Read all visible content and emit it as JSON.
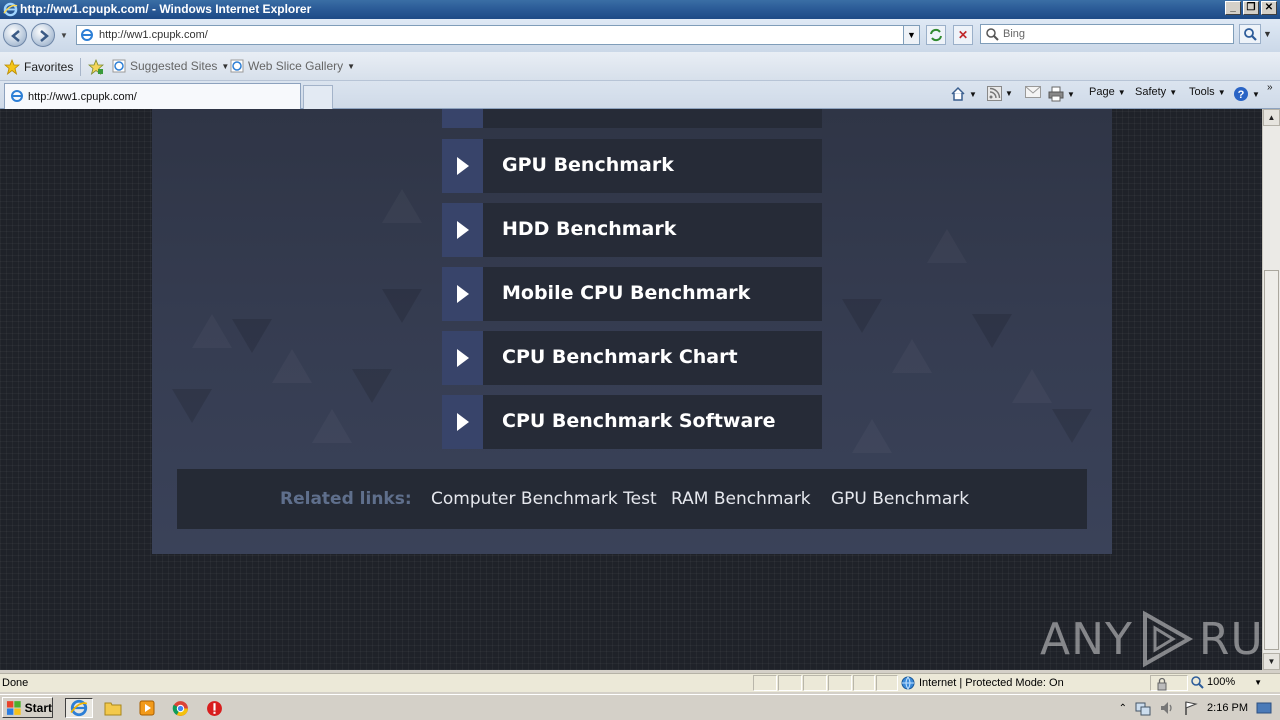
{
  "window": {
    "title": "http://ww1.cpupk.com/ - Windows Internet Explorer",
    "controls": {
      "minimize": "_",
      "maximize": "❐",
      "close": "✕"
    }
  },
  "address_bar": {
    "url": "http://ww1.cpupk.com/",
    "search_placeholder": "Bing"
  },
  "favorites_bar": {
    "favorites_label": "Favorites",
    "suggested_sites": "Suggested Sites",
    "web_slice_gallery": "Web Slice Gallery"
  },
  "tabs": {
    "active_tab_label": "http://ww1.cpupk.com/"
  },
  "command_bar": {
    "page": "Page",
    "safety": "Safety",
    "tools": "Tools"
  },
  "page": {
    "menu_items": [
      {
        "label": "GPU Benchmark"
      },
      {
        "label": "HDD Benchmark"
      },
      {
        "label": "Mobile CPU Benchmark"
      },
      {
        "label": "CPU Benchmark Chart"
      },
      {
        "label": "CPU Benchmark Software"
      }
    ],
    "related": {
      "label": "Related links:",
      "links": [
        "Computer Benchmark Test",
        "RAM Benchmark",
        "GPU Benchmark"
      ]
    },
    "watermark": {
      "left": "ANY",
      "right": "RUN"
    }
  },
  "status_bar": {
    "status": "Done",
    "zone": "Internet | Protected Mode: On",
    "zoom": "100%"
  },
  "taskbar": {
    "start": "Start",
    "clock": "2:16 PM"
  },
  "colors": {
    "menu_item_bg": "#262b37",
    "menu_arrow_bg": "#38446a",
    "related_label": "#5f6f8c",
    "page_bg": "#1f2229"
  }
}
